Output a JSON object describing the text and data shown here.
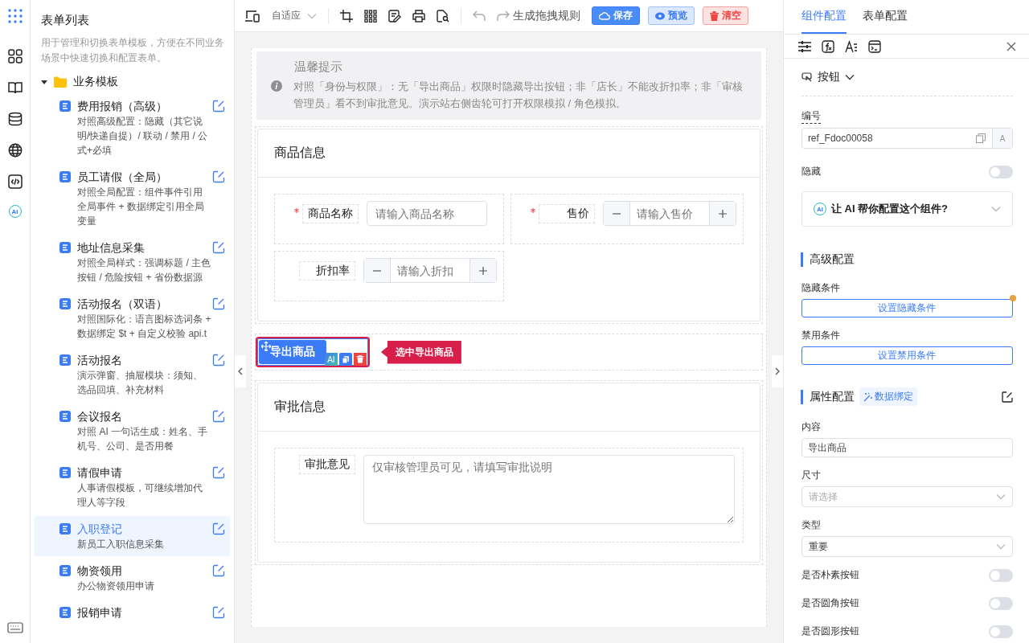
{
  "rail": {
    "ai_badge": "AI"
  },
  "sidebar": {
    "title": "表单列表",
    "description": "用于管理和切换表单模板，方便在不同业务场景中快速切换和配置表单。",
    "folder": {
      "label": "业务模板",
      "expanded": true,
      "items": [
        {
          "title": "费用报销（高级）",
          "desc": "对照高级配置：隐藏（其它说明/快递自提）/ 联动 / 禁用 / 公式+必填",
          "selected": false
        },
        {
          "title": "员工请假（全局）",
          "desc": "对照全局配置：组件事件引用全局事件 + 数据绑定引用全局变量",
          "selected": false
        },
        {
          "title": "地址信息采集",
          "desc": "对照全局样式：强调标题 / 主色按钮 / 危险按钮 + 省份数据源",
          "selected": false
        },
        {
          "title": "活动报名（双语）",
          "desc": "对照国际化：语言图标选词条 + 数据绑定 $t + 自定义校验 api.t",
          "selected": false
        },
        {
          "title": "活动报名",
          "desc": "演示弹窗、抽屉模块：须知、选品回填、补充材料",
          "selected": false
        },
        {
          "title": "会议报名",
          "desc": "对照 AI 一句话生成：姓名、手机号、公司、是否用餐",
          "selected": false
        },
        {
          "title": "请假申请",
          "desc": "人事请假模板，可继续增加代理人等字段",
          "selected": false
        },
        {
          "title": "入职登记",
          "desc": "新员工入职信息采集",
          "selected": true
        },
        {
          "title": "物资领用",
          "desc": "办公物资领用申请",
          "selected": false
        },
        {
          "title": "报销申请",
          "selected": false
        }
      ]
    }
  },
  "toolbar": {
    "device": "自适应",
    "rule_button": "生成拖拽规则",
    "actions": [
      {
        "kind": "primary",
        "label": "保存"
      },
      {
        "kind": "info",
        "label": "预览"
      },
      {
        "kind": "danger",
        "label": "清空"
      }
    ]
  },
  "canvas": {
    "notice": {
      "title": "温馨提示",
      "text": "对照「身份与权限」：无「导出商品」权限时隐藏导出按钮；非「店长」不能改折扣率；非「审核管理员」看不到审批意见。演示站右侧齿轮可打开权限模拟 / 角色模拟。"
    },
    "sections": [
      {
        "title": "商品信息",
        "fields": [
          {
            "kind": "input",
            "label": "商品名称",
            "required": true,
            "placeholder": "请输入商品名称"
          },
          {
            "kind": "number",
            "label": "售价",
            "required": true,
            "placeholder": "请输入售价"
          },
          {
            "kind": "number",
            "label": "折扣率",
            "required": false,
            "placeholder": "请输入折扣"
          }
        ]
      },
      {
        "kind": "button",
        "label": "导出商品",
        "selected": true,
        "ai_label": "AI",
        "tip": "选中导出商品"
      },
      {
        "title": "审批信息",
        "fields": [
          {
            "kind": "textarea",
            "label": "审批意见",
            "required": false,
            "placeholder": "仅审核管理员可见，请填写审批说明"
          }
        ]
      }
    ]
  },
  "panel": {
    "tabs": [
      {
        "label": "组件配置",
        "selected": true
      },
      {
        "label": "表单配置",
        "selected": false
      }
    ],
    "component_type": "按钮",
    "id_field": {
      "label": "编号",
      "value": "ref_Fdoc00058",
      "badge": "A"
    },
    "hidden": {
      "label": "隐藏",
      "on": false
    },
    "ai_prompt": {
      "badge": "AI",
      "text": "让 AI 帮你配置这个组件?"
    },
    "advanced": {
      "title": "高级配置",
      "rows": [
        {
          "label": "隐藏条件",
          "button": "设置隐藏条件",
          "flagged": true
        },
        {
          "label": "禁用条件",
          "button": "设置禁用条件",
          "flagged": false
        }
      ]
    },
    "props": {
      "title": "属性配置",
      "tag": "数据绑定",
      "fields": [
        {
          "kind": "input",
          "label": "内容",
          "value": "导出商品"
        },
        {
          "kind": "select",
          "label": "尺寸",
          "placeholder": "请选择"
        },
        {
          "kind": "select",
          "label": "类型",
          "value": "重要"
        },
        {
          "kind": "toggle",
          "label": "是否朴素按钮",
          "on": false
        },
        {
          "kind": "toggle",
          "label": "是否圆角按钮",
          "on": false
        },
        {
          "kind": "toggle",
          "label": "是否圆形按钮",
          "on": false
        }
      ]
    }
  }
}
